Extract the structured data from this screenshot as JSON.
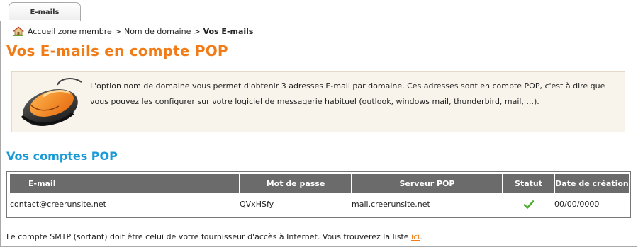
{
  "tabs": [
    {
      "label": "E-mails",
      "active": true
    }
  ],
  "breadcrumb": {
    "home": "Accueil zone membre",
    "sep1": ">",
    "domain": "Nom de domaine",
    "sep2": ">",
    "current": "Vos E-mails"
  },
  "page_title": "Vos E-mails en compte POP",
  "info": {
    "text": "L'option nom de domaine vous permet d'obtenir 3 adresses E-mail par domaine. Ces adresses sont en compte POP, c'est à dire que vous pouvez les configurer sur votre logiciel de messagerie habituel (outlook, windows mail, thunderbird, mail, ...).",
    "icon": "computer-mouse-icon"
  },
  "section_title": "Vos comptes POP",
  "table": {
    "headers": {
      "email": "E-mail",
      "password": "Mot de passe",
      "server": "Serveur POP",
      "status": "Statut",
      "date": "Date de création"
    },
    "rows": [
      {
        "email": "contact@creerunsite.net",
        "password": "QVxHSfy",
        "server": "mail.creerunsite.net",
        "status_icon": "check-icon",
        "date": "00/00/0000"
      }
    ]
  },
  "footer": {
    "text": "Le compte SMTP (sortant) doit être celui de votre fournisseur d'accès à Internet. Vous trouverez la liste",
    "link": "ici",
    "end": "."
  },
  "colors": {
    "title_orange": "#f07b17",
    "section_blue": "#1a9ad6",
    "header_gray": "#6b6b6b",
    "info_bg": "#f8f4ec",
    "check_green": "#4caf2a"
  }
}
